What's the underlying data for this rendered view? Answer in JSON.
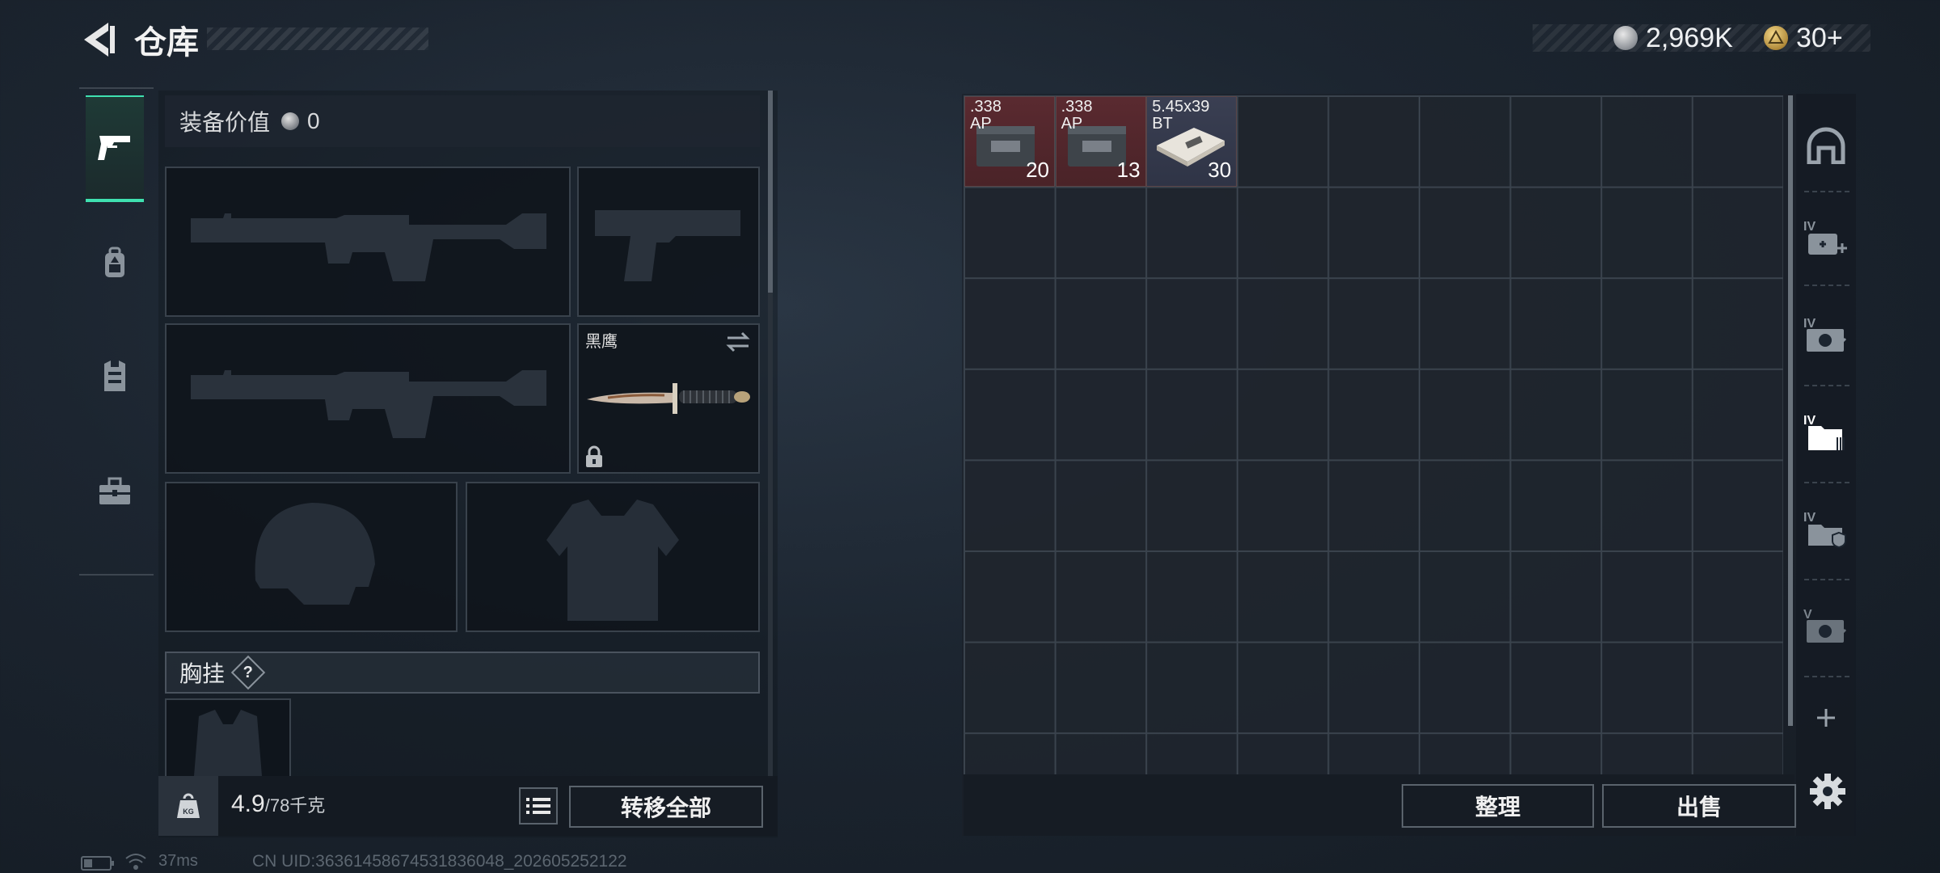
{
  "header": {
    "title": "仓库",
    "currency_silver": "2,969K",
    "currency_gold": "30+"
  },
  "rail_tabs": [
    {
      "icon": "pistol-icon",
      "active": true
    },
    {
      "icon": "backpack-icon",
      "active": false
    },
    {
      "icon": "vest-icon",
      "active": false
    },
    {
      "icon": "toolbox-icon",
      "active": false
    }
  ],
  "loadout": {
    "value_label": "装备价值",
    "value": "0",
    "melee_name": "黑鹰",
    "chest_label": "胸挂",
    "chest_help": "?"
  },
  "footer_left": {
    "weight_value": "4.9",
    "weight_cap": "/78千克",
    "kg_badge": "KG",
    "transfer_all": "转移全部"
  },
  "stash": {
    "items": [
      {
        "line1": ".338",
        "line2": "AP",
        "count": "20",
        "rarity": "red"
      },
      {
        "line1": ".338",
        "line2": "AP",
        "count": "13",
        "rarity": "red"
      },
      {
        "line1": "5.45x39",
        "line2": "BT",
        "count": "30",
        "rarity": "blue"
      }
    ],
    "side_tabs": [
      {
        "icon": "armory-icon",
        "tier": ""
      },
      {
        "icon": "medkit-container-icon",
        "tier": "IV"
      },
      {
        "icon": "ammo-container-icon",
        "tier": "IV"
      },
      {
        "icon": "folder-container-icon",
        "tier": "IV"
      },
      {
        "icon": "shield-container-icon",
        "tier": "IV"
      },
      {
        "icon": "ammo-container-icon",
        "tier": "V"
      }
    ],
    "organize": "整理",
    "sell": "出售"
  },
  "status": {
    "ping": "37ms",
    "uid": "CN UID:36361458674531836048_202605252122"
  }
}
